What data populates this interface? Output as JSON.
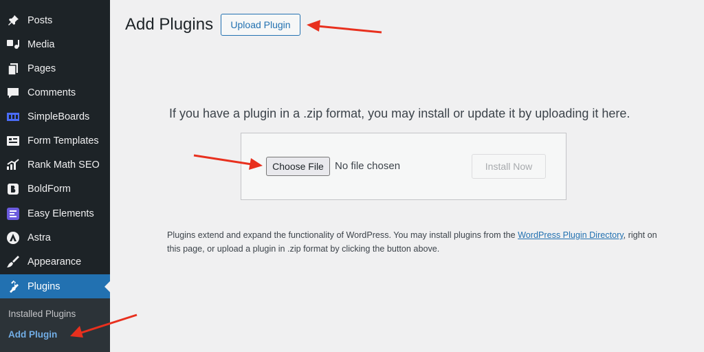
{
  "sidebar": {
    "items": [
      {
        "label": "Posts",
        "icon": "pin-icon"
      },
      {
        "label": "Media",
        "icon": "media-icon"
      },
      {
        "label": "Pages",
        "icon": "pages-icon"
      },
      {
        "label": "Comments",
        "icon": "comment-icon"
      },
      {
        "label": "SimpleBoards",
        "icon": "board-icon"
      },
      {
        "label": "Form Templates",
        "icon": "form-icon"
      },
      {
        "label": "Rank Math SEO",
        "icon": "rank-math-icon"
      },
      {
        "label": "BoldForm",
        "icon": "boldform-icon"
      },
      {
        "label": "Easy Elements",
        "icon": "elements-icon"
      },
      {
        "label": "Astra",
        "icon": "astra-icon"
      },
      {
        "label": "Appearance",
        "icon": "brush-icon"
      },
      {
        "label": "Plugins",
        "icon": "plug-icon",
        "active": true
      }
    ],
    "submenu": [
      {
        "label": "Installed Plugins"
      },
      {
        "label": "Add Plugin",
        "current": true
      }
    ]
  },
  "main": {
    "title": "Add Plugins",
    "upload_button": "Upload Plugin",
    "help_text": "If you have a plugin in a .zip format, you may install or update it by uploading it here.",
    "choose_file": "Choose File",
    "file_status": "No file chosen",
    "install_button": "Install Now",
    "info_before": "Plugins extend and expand the functionality of WordPress. You may install plugins from the ",
    "info_link": "WordPress Plugin Directory",
    "info_after": ", right on this page, or upload a plugin in .zip format by clicking the button above."
  },
  "colors": {
    "sidebar_bg": "#1d2327",
    "accent": "#2271b1",
    "annotation_arrow": "#e8301e"
  }
}
